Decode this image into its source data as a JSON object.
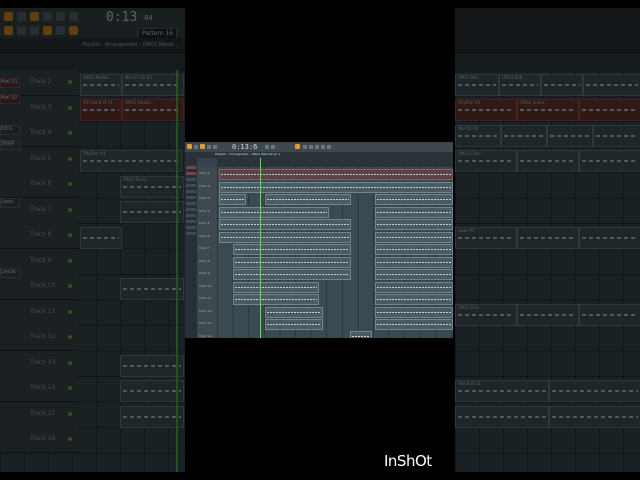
{
  "left_view": {
    "time_display": "0:13",
    "time_fraction": "'04",
    "pattern_selector": "Pattern 16",
    "breadcrumb": "Playlist - Arrangement › (PKG) Melod…",
    "tracks": [
      "Track 2",
      "Track 3",
      "Track 4",
      "Track 5",
      "Track 6",
      "Track 7",
      "Track 8",
      "Track 9",
      "Track 10",
      "Track 11",
      "Track 12",
      "Track 13",
      "Track 14",
      "Track 15",
      "Track 16"
    ],
    "side_labels": [
      "Mel 01",
      "Mel 02",
      "KICK",
      "SNAP",
      "Lead",
      "Leads"
    ],
    "clip_labels": [
      "(PKG) Melod...",
      "Mel 01 Fill #2",
      "#2 Pad 8 of 11",
      "(PKG) Melod...",
      "Rhythm #1",
      "(PKG) Drum..."
    ]
  },
  "center_window": {
    "time_display": "0:13:6",
    "title": "Playlist - Arrangement › (PKG) Melodie Lp 1",
    "tracks": [
      "Track 1",
      "Track 2",
      "Track 3",
      "Track 4",
      "Track 5",
      "Track 6",
      "Track 7",
      "Track 8",
      "Track 9",
      "Track 10",
      "Track 11",
      "Track 12",
      "Track 13",
      "Track 14"
    ]
  },
  "right_view": {
    "clip_labels": [
      "(PKG) Mel...",
      "(PKG) 808",
      "Rhythm #1",
      "(PKG) Snare...",
      "Mel 01 Fill",
      "(PKG) Clap...",
      "Lead #1",
      "(PKG) Kick...",
      "Pad 8 of 11"
    ]
  },
  "watermark": "InShOt",
  "colors": {
    "accent": "#d8891e",
    "playhead": "#57d03e",
    "background": "#2f3b41"
  }
}
